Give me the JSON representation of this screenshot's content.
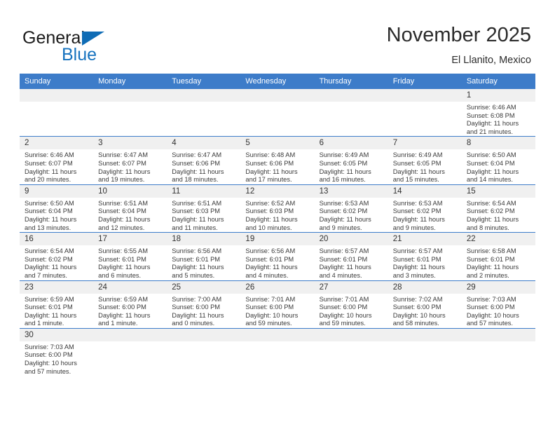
{
  "logo": {
    "word1": "General",
    "word2": "Blue",
    "flag_icon": "blue-triangle-flag",
    "accent_color": "#1773bf"
  },
  "header": {
    "month_title": "November 2025",
    "location": "El Llanito, Mexico"
  },
  "theme": {
    "header_blue": "#3d7cc9",
    "daynum_bg": "#f0f0f0",
    "text": "#3a3a3a"
  },
  "calendar": {
    "weekday_headers": [
      "Sunday",
      "Monday",
      "Tuesday",
      "Wednesday",
      "Thursday",
      "Friday",
      "Saturday"
    ],
    "weeks": [
      [
        {
          "blank": true
        },
        {
          "blank": true
        },
        {
          "blank": true
        },
        {
          "blank": true
        },
        {
          "blank": true
        },
        {
          "blank": true
        },
        {
          "day": "1",
          "sunrise": "Sunrise: 6:46 AM",
          "sunset": "Sunset: 6:08 PM",
          "daylight1": "Daylight: 11 hours",
          "daylight2": "and 21 minutes."
        }
      ],
      [
        {
          "day": "2",
          "sunrise": "Sunrise: 6:46 AM",
          "sunset": "Sunset: 6:07 PM",
          "daylight1": "Daylight: 11 hours",
          "daylight2": "and 20 minutes."
        },
        {
          "day": "3",
          "sunrise": "Sunrise: 6:47 AM",
          "sunset": "Sunset: 6:07 PM",
          "daylight1": "Daylight: 11 hours",
          "daylight2": "and 19 minutes."
        },
        {
          "day": "4",
          "sunrise": "Sunrise: 6:47 AM",
          "sunset": "Sunset: 6:06 PM",
          "daylight1": "Daylight: 11 hours",
          "daylight2": "and 18 minutes."
        },
        {
          "day": "5",
          "sunrise": "Sunrise: 6:48 AM",
          "sunset": "Sunset: 6:06 PM",
          "daylight1": "Daylight: 11 hours",
          "daylight2": "and 17 minutes."
        },
        {
          "day": "6",
          "sunrise": "Sunrise: 6:49 AM",
          "sunset": "Sunset: 6:05 PM",
          "daylight1": "Daylight: 11 hours",
          "daylight2": "and 16 minutes."
        },
        {
          "day": "7",
          "sunrise": "Sunrise: 6:49 AM",
          "sunset": "Sunset: 6:05 PM",
          "daylight1": "Daylight: 11 hours",
          "daylight2": "and 15 minutes."
        },
        {
          "day": "8",
          "sunrise": "Sunrise: 6:50 AM",
          "sunset": "Sunset: 6:04 PM",
          "daylight1": "Daylight: 11 hours",
          "daylight2": "and 14 minutes."
        }
      ],
      [
        {
          "day": "9",
          "sunrise": "Sunrise: 6:50 AM",
          "sunset": "Sunset: 6:04 PM",
          "daylight1": "Daylight: 11 hours",
          "daylight2": "and 13 minutes."
        },
        {
          "day": "10",
          "sunrise": "Sunrise: 6:51 AM",
          "sunset": "Sunset: 6:04 PM",
          "daylight1": "Daylight: 11 hours",
          "daylight2": "and 12 minutes."
        },
        {
          "day": "11",
          "sunrise": "Sunrise: 6:51 AM",
          "sunset": "Sunset: 6:03 PM",
          "daylight1": "Daylight: 11 hours",
          "daylight2": "and 11 minutes."
        },
        {
          "day": "12",
          "sunrise": "Sunrise: 6:52 AM",
          "sunset": "Sunset: 6:03 PM",
          "daylight1": "Daylight: 11 hours",
          "daylight2": "and 10 minutes."
        },
        {
          "day": "13",
          "sunrise": "Sunrise: 6:53 AM",
          "sunset": "Sunset: 6:02 PM",
          "daylight1": "Daylight: 11 hours",
          "daylight2": "and 9 minutes."
        },
        {
          "day": "14",
          "sunrise": "Sunrise: 6:53 AM",
          "sunset": "Sunset: 6:02 PM",
          "daylight1": "Daylight: 11 hours",
          "daylight2": "and 9 minutes."
        },
        {
          "day": "15",
          "sunrise": "Sunrise: 6:54 AM",
          "sunset": "Sunset: 6:02 PM",
          "daylight1": "Daylight: 11 hours",
          "daylight2": "and 8 minutes."
        }
      ],
      [
        {
          "day": "16",
          "sunrise": "Sunrise: 6:54 AM",
          "sunset": "Sunset: 6:02 PM",
          "daylight1": "Daylight: 11 hours",
          "daylight2": "and 7 minutes."
        },
        {
          "day": "17",
          "sunrise": "Sunrise: 6:55 AM",
          "sunset": "Sunset: 6:01 PM",
          "daylight1": "Daylight: 11 hours",
          "daylight2": "and 6 minutes."
        },
        {
          "day": "18",
          "sunrise": "Sunrise: 6:56 AM",
          "sunset": "Sunset: 6:01 PM",
          "daylight1": "Daylight: 11 hours",
          "daylight2": "and 5 minutes."
        },
        {
          "day": "19",
          "sunrise": "Sunrise: 6:56 AM",
          "sunset": "Sunset: 6:01 PM",
          "daylight1": "Daylight: 11 hours",
          "daylight2": "and 4 minutes."
        },
        {
          "day": "20",
          "sunrise": "Sunrise: 6:57 AM",
          "sunset": "Sunset: 6:01 PM",
          "daylight1": "Daylight: 11 hours",
          "daylight2": "and 4 minutes."
        },
        {
          "day": "21",
          "sunrise": "Sunrise: 6:57 AM",
          "sunset": "Sunset: 6:01 PM",
          "daylight1": "Daylight: 11 hours",
          "daylight2": "and 3 minutes."
        },
        {
          "day": "22",
          "sunrise": "Sunrise: 6:58 AM",
          "sunset": "Sunset: 6:01 PM",
          "daylight1": "Daylight: 11 hours",
          "daylight2": "and 2 minutes."
        }
      ],
      [
        {
          "day": "23",
          "sunrise": "Sunrise: 6:59 AM",
          "sunset": "Sunset: 6:01 PM",
          "daylight1": "Daylight: 11 hours",
          "daylight2": "and 1 minute."
        },
        {
          "day": "24",
          "sunrise": "Sunrise: 6:59 AM",
          "sunset": "Sunset: 6:00 PM",
          "daylight1": "Daylight: 11 hours",
          "daylight2": "and 1 minute."
        },
        {
          "day": "25",
          "sunrise": "Sunrise: 7:00 AM",
          "sunset": "Sunset: 6:00 PM",
          "daylight1": "Daylight: 11 hours",
          "daylight2": "and 0 minutes."
        },
        {
          "day": "26",
          "sunrise": "Sunrise: 7:01 AM",
          "sunset": "Sunset: 6:00 PM",
          "daylight1": "Daylight: 10 hours",
          "daylight2": "and 59 minutes."
        },
        {
          "day": "27",
          "sunrise": "Sunrise: 7:01 AM",
          "sunset": "Sunset: 6:00 PM",
          "daylight1": "Daylight: 10 hours",
          "daylight2": "and 59 minutes."
        },
        {
          "day": "28",
          "sunrise": "Sunrise: 7:02 AM",
          "sunset": "Sunset: 6:00 PM",
          "daylight1": "Daylight: 10 hours",
          "daylight2": "and 58 minutes."
        },
        {
          "day": "29",
          "sunrise": "Sunrise: 7:03 AM",
          "sunset": "Sunset: 6:00 PM",
          "daylight1": "Daylight: 10 hours",
          "daylight2": "and 57 minutes."
        }
      ],
      [
        {
          "day": "30",
          "sunrise": "Sunrise: 7:03 AM",
          "sunset": "Sunset: 6:00 PM",
          "daylight1": "Daylight: 10 hours",
          "daylight2": "and 57 minutes."
        },
        {
          "blank": true
        },
        {
          "blank": true
        },
        {
          "blank": true
        },
        {
          "blank": true
        },
        {
          "blank": true
        },
        {
          "blank": true
        }
      ]
    ]
  }
}
